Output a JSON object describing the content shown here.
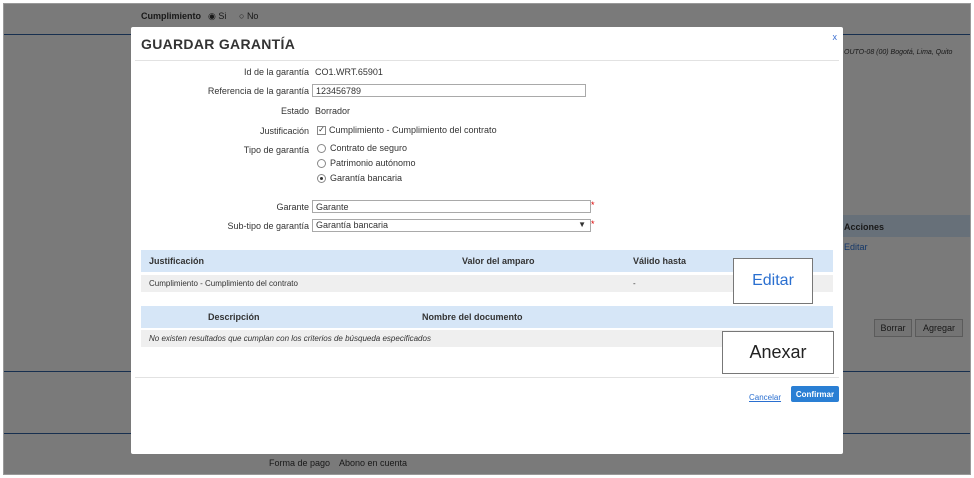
{
  "background": {
    "cumplimiento_label": "Cumplimiento",
    "si_label": "Si",
    "no_label": "No",
    "address_text": "OUTO-08 (00) Bogotá, Lima, Quito",
    "acciones_header": "Acciones",
    "editar_link": "Editar",
    "borrar_button": "Borrar",
    "agregar_button": "Agregar",
    "forma_pago_label": "Forma de pago",
    "forma_pago_value": "Abono en cuenta"
  },
  "modal": {
    "title": "GUARDAR GARANTÍA",
    "close_label": "x",
    "fields": {
      "id_label": "Id de la garantía",
      "id_value": "CO1.WRT.65901",
      "referencia_label": "Referencia de la garantía",
      "referencia_value": "123456789",
      "estado_label": "Estado",
      "estado_value": "Borrador",
      "justificacion_label": "Justificación",
      "justificacion_option": "Cumplimiento - Cumplimiento del contrato",
      "tipo_label": "Tipo de garantía",
      "tipo_options": [
        "Contrato de seguro",
        "Patrimonio autónomo",
        "Garantía bancaria"
      ],
      "tipo_selected_index": 2,
      "garante_label": "Garante",
      "garante_value": "Garante",
      "subtipo_label": "Sub-tipo de garantía",
      "subtipo_value": "Garantía bancaria",
      "required_mark": "*"
    },
    "table1": {
      "headers": [
        "Justificación",
        "Valor del amparo",
        "Válido hasta"
      ],
      "rows": [
        [
          "Cumplimiento - Cumplimiento del contrato",
          "",
          "-"
        ]
      ]
    },
    "table2": {
      "headers": [
        "Descripción",
        "Nombre del documento"
      ],
      "empty_message": "No existen resultados que cumplan con los criterios de búsqueda especificados"
    },
    "callouts": {
      "editar": "Editar",
      "anexar": "Anexar"
    },
    "cancel_label": "Cancelar",
    "confirm_label": "Confirmar"
  },
  "colors": {
    "accent": "#2a7fd4",
    "table_header": "#d6e6f7",
    "required": "#dd0000"
  }
}
